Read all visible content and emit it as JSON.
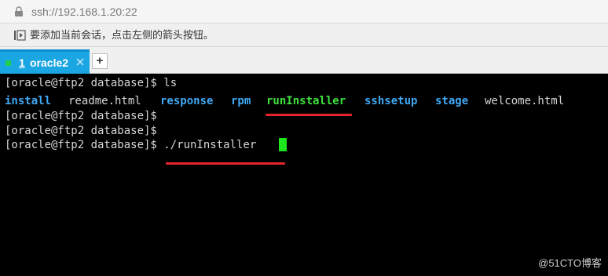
{
  "address_bar": {
    "icon": "lock-icon",
    "url": "ssh://192.168.1.20:22"
  },
  "hint_bar": {
    "icon": "send-keys-icon",
    "text": "要添加当前会话，点击左侧的箭头按钮。"
  },
  "tabs": [
    {
      "index": "1",
      "label": "oracle2",
      "active": true,
      "status_color": "#1ed04a"
    }
  ],
  "new_tab_label": "+",
  "terminal": {
    "lines": [
      "[oracle@ftp2 database]$ ls",
      "",
      "[oracle@ftp2 database]$",
      "[oracle@ftp2 database]$",
      "[oracle@ftp2 database]$ ./runInstaller"
    ],
    "ls_output": [
      {
        "name": "install",
        "kind": "directory",
        "color": "#3fa9f5"
      },
      {
        "name": "readme.html",
        "kind": "file",
        "color": "#d6d6d6"
      },
      {
        "name": "response",
        "kind": "directory",
        "color": "#3fa9f5"
      },
      {
        "name": "rpm",
        "kind": "directory",
        "color": "#3fa9f5"
      },
      {
        "name": "runInstaller",
        "kind": "executable",
        "color": "#3ee23e"
      },
      {
        "name": "sshsetup",
        "kind": "directory",
        "color": "#3fa9f5"
      },
      {
        "name": "stage",
        "kind": "directory",
        "color": "#3fa9f5"
      },
      {
        "name": "welcome.html",
        "kind": "file",
        "color": "#d6d6d6"
      }
    ],
    "cursor_color": "#1ee61e",
    "annotation_color": "#e8232b"
  },
  "watermark": "@51CTO博客",
  "colors": {
    "tab_active": "#1aa5e3",
    "terminal_bg": "#000000",
    "terminal_fg": "#d6d6d6"
  }
}
